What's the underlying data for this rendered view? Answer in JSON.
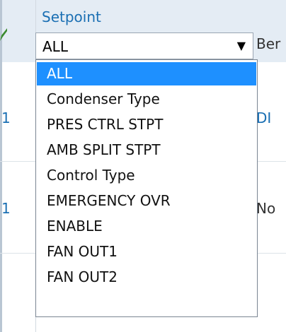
{
  "header": {
    "label": "Setpoint",
    "right_partial": "Ber"
  },
  "filter": {
    "selected": "ALL"
  },
  "rows": [
    {
      "num": "1",
      "right": "DI"
    },
    {
      "num": "1",
      "right": "No"
    }
  ],
  "options": [
    {
      "label": "ALL",
      "selected": true
    },
    {
      "label": "Condenser Type"
    },
    {
      "label": "PRES CTRL STPT"
    },
    {
      "label": "AMB SPLIT STPT"
    },
    {
      "label": "Control Type"
    },
    {
      "label": "EMERGENCY OVR"
    },
    {
      "label": "ENABLE"
    },
    {
      "label": "FAN OUT1"
    },
    {
      "label": "FAN OUT2"
    }
  ],
  "icons": {
    "edit": "pencil-icon",
    "dropdown": "triangle-down-icon"
  }
}
